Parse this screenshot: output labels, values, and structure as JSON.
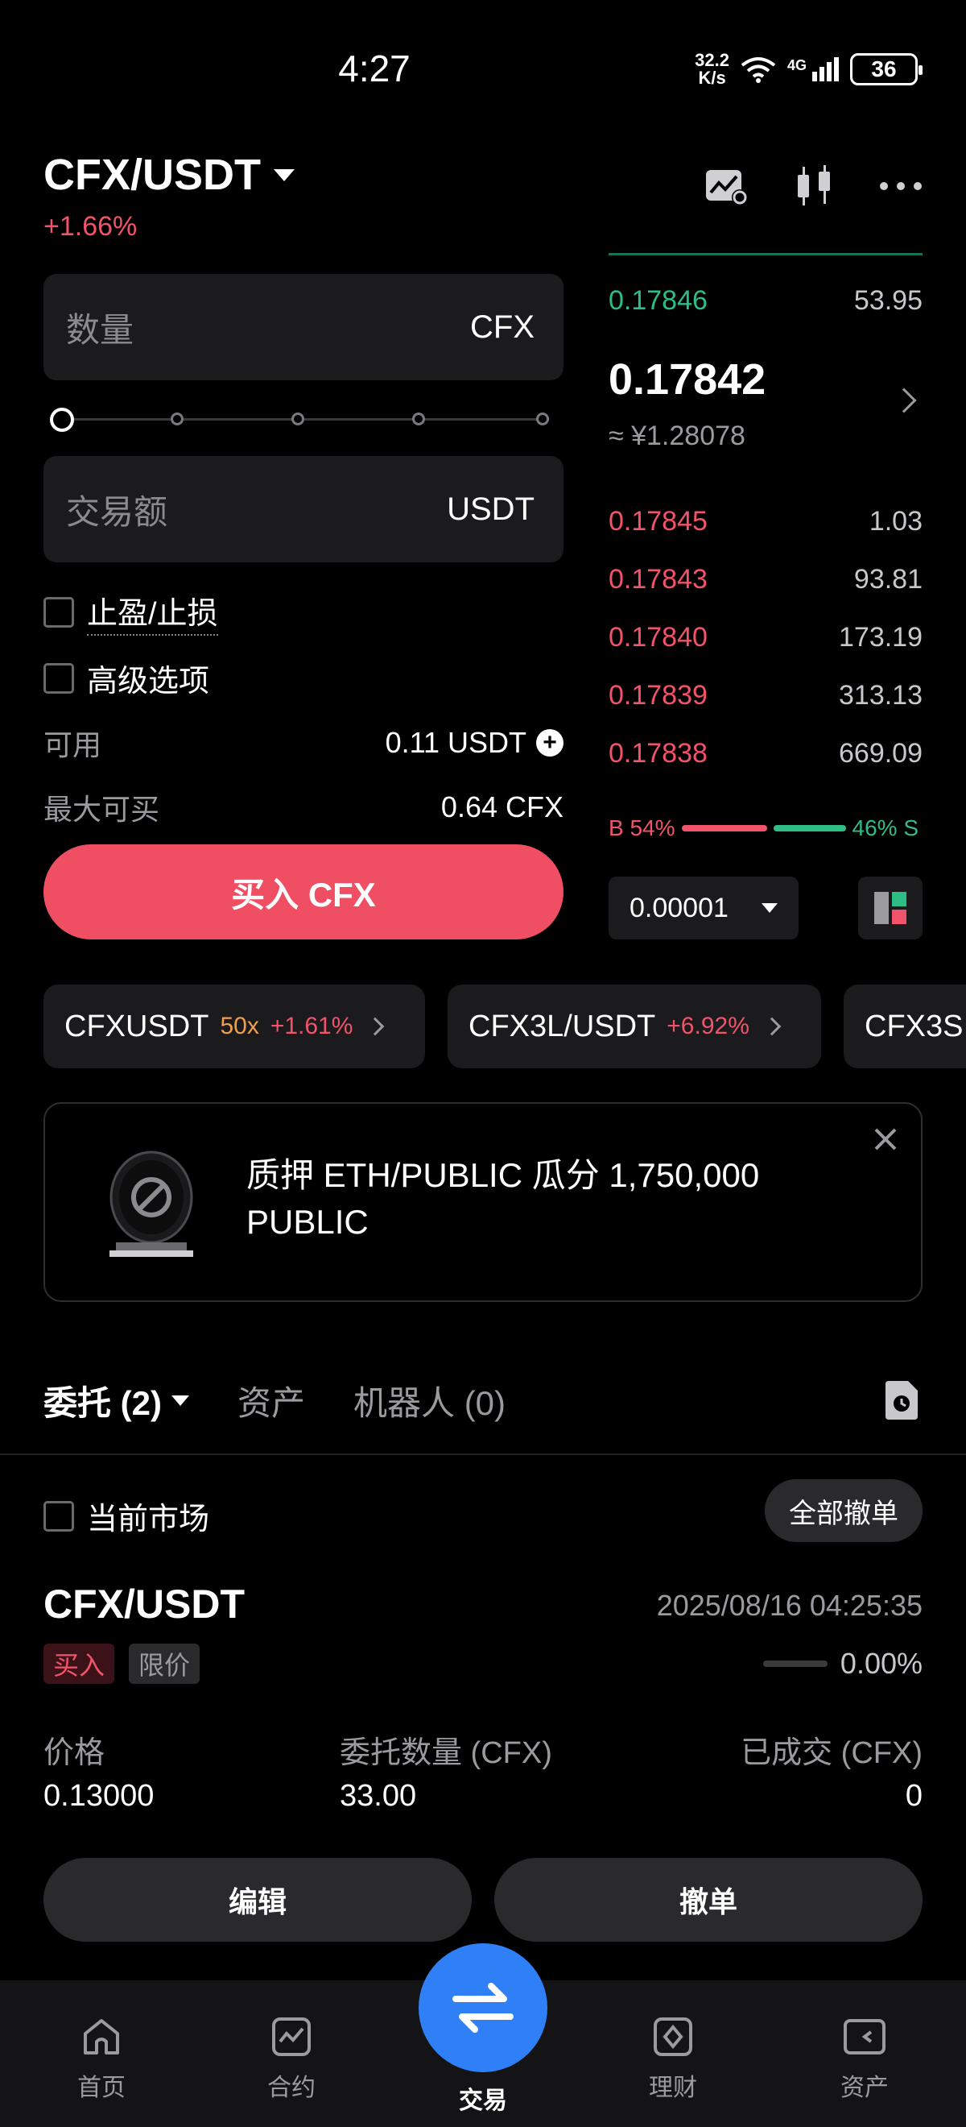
{
  "status_bar": {
    "time": "4:27",
    "net_speed_value": "32.2",
    "net_speed_unit": "K/s",
    "network": "4G",
    "battery": "36"
  },
  "header": {
    "pair": "CFX/USDT",
    "change": "+1.66%"
  },
  "form": {
    "amount_placeholder": "数量",
    "amount_unit": "CFX",
    "total_placeholder": "交易额",
    "total_unit": "USDT",
    "tp_sl_label": "止盈/止损",
    "advanced_label": "高级选项",
    "available_label": "可用",
    "available_value": "0.11 USDT",
    "max_buy_label": "最大可买",
    "max_buy_value": "0.64 CFX",
    "buy_button": "买入 CFX"
  },
  "orderbook": {
    "top_partial_price": "0.17846",
    "top_partial_qty": "53.95",
    "mid_price": "0.17842",
    "mid_cny": "≈ ¥1.28078",
    "bids": [
      {
        "price": "0.17845",
        "qty": "1.03"
      },
      {
        "price": "0.17843",
        "qty": "93.81"
      },
      {
        "price": "0.17840",
        "qty": "173.19"
      },
      {
        "price": "0.17839",
        "qty": "313.13"
      },
      {
        "price": "0.17838",
        "qty": "669.09"
      }
    ],
    "buy_ratio_label": "B 54%",
    "sell_ratio_label": "46% S",
    "buy_ratio": 0.54,
    "tick_size": "0.00001"
  },
  "related": [
    {
      "name": "CFXUSDT",
      "leverage": "50x",
      "change": "+1.61%"
    },
    {
      "name": "CFX3L/USDT",
      "leverage": "",
      "change": "+6.92%"
    },
    {
      "name": "CFX3S",
      "leverage": "",
      "change": ""
    }
  ],
  "banner": {
    "text": "质押 ETH/PUBLIC 瓜分 1,750,000 PUBLIC"
  },
  "tabs": {
    "orders": "委托 (2)",
    "assets": "资产",
    "bots": "机器人 (0)"
  },
  "filter": {
    "current_market": "当前市场",
    "cancel_all": "全部撤单"
  },
  "order": {
    "pair": "CFX/USDT",
    "time": "2025/08/16 04:25:35",
    "side_tag": "买入",
    "type_tag": "限价",
    "progress": "0.00%",
    "price_label": "价格",
    "price_value": "0.13000",
    "qty_label": "委托数量 (CFX)",
    "qty_value": "33.00",
    "filled_label": "已成交 (CFX)",
    "filled_value": "0",
    "edit_button": "编辑",
    "cancel_button": "撤单"
  },
  "nav": {
    "home": "首页",
    "futures": "合约",
    "trade": "交易",
    "earn": "理财",
    "assets": "资产"
  },
  "colors": {
    "up": "#2ebd85",
    "down": "#f0536a",
    "accent": "#2f80f7"
  }
}
